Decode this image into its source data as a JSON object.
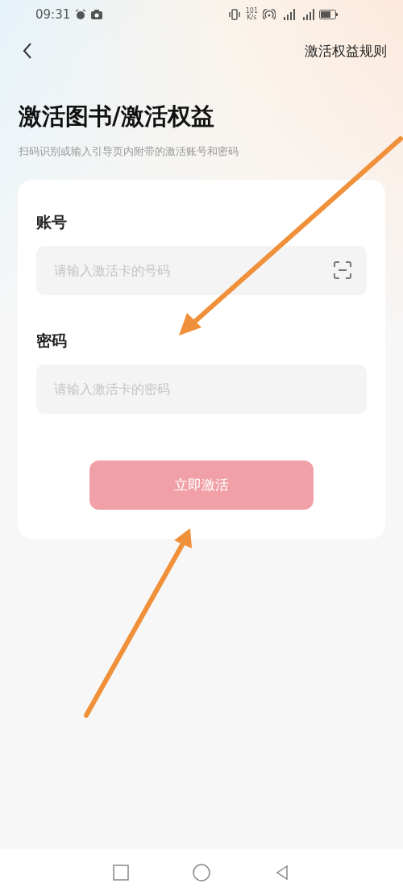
{
  "status_bar": {
    "time": "09:31",
    "network_speed": "101\nK/s"
  },
  "header": {
    "rules_link": "激活权益规则"
  },
  "title": "激活图书/激活权益",
  "subtitle": "扫码识别或输入引导页内附带的激活账号和密码",
  "fields": [
    {
      "label": "账号",
      "placeholder": "请输入激活卡的号码",
      "kind": "scan"
    },
    {
      "label": "密码",
      "placeholder": "请输入激活卡的密码",
      "kind": "plain"
    }
  ],
  "submit": {
    "label": "立即激活",
    "disabled": true
  }
}
